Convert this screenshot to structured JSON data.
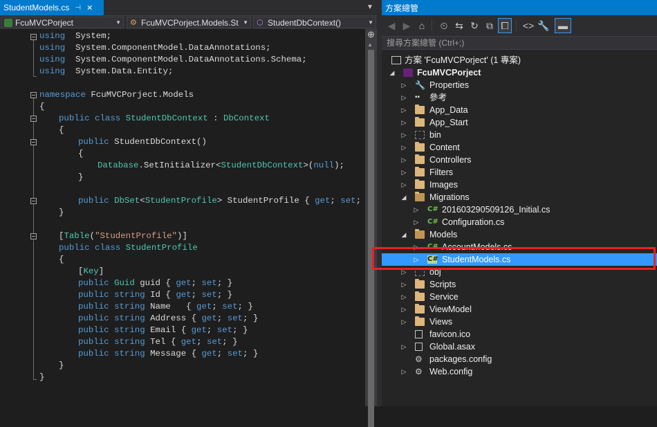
{
  "colors": {
    "accent": "#007acc",
    "keyword": "#569cd6",
    "type": "#4ec9b0",
    "string": "#d69d85",
    "selection": "#3399ff",
    "highlight_box": "#e8202a"
  },
  "editor": {
    "tab": {
      "label": "StudentModels.cs",
      "pin_icon": "pin-icon",
      "close_icon": "close-icon"
    },
    "nav": {
      "project": "FcuMVCPorject",
      "class": "FcuMVCPorject.Models.St",
      "member": "StudentDbContext()"
    },
    "lines": [
      [
        "using ",
        " System;"
      ],
      [
        "using ",
        " System.ComponentModel.DataAnnotations;"
      ],
      [
        "using ",
        " System.ComponentModel.DataAnnotations.Schema;"
      ],
      [
        "using ",
        " System.Data.Entity;"
      ],
      [
        "namespace ",
        "FcuMVCPorject.Models"
      ],
      [
        "{"
      ],
      [
        "public class ",
        "StudentDbContext",
        " : ",
        "DbContext"
      ],
      [
        "{"
      ],
      [
        "public ",
        "StudentDbContext",
        "()"
      ],
      [
        "{"
      ],
      [
        "Database",
        ".SetInitializer<",
        "StudentDbContext",
        ">(",
        "null",
        ");"
      ],
      [
        "}"
      ],
      [
        "public ",
        "DbSet",
        "<",
        "StudentProfile",
        "> StudentProfile { ",
        "get",
        "; ",
        "set",
        "; }"
      ],
      [
        "}"
      ],
      [
        "[",
        "Table",
        "(",
        "\"StudentProfile\"",
        ")]"
      ],
      [
        "public class ",
        "StudentProfile"
      ],
      [
        "{"
      ],
      [
        "[",
        "Key",
        "]"
      ],
      [
        "public ",
        "Guid",
        " guid { ",
        "get",
        "; ",
        "set",
        "; }"
      ],
      [
        "public ",
        "string",
        " Id { ",
        "get",
        "; ",
        "set",
        "; }"
      ],
      [
        "public ",
        "string",
        " Name   { ",
        "get",
        "; ",
        "set",
        "; }"
      ],
      [
        "public ",
        "string",
        " Address { ",
        "get",
        "; ",
        "set",
        "; }"
      ],
      [
        "public ",
        "string",
        " Email { ",
        "get",
        "; ",
        "set",
        "; }"
      ],
      [
        "public ",
        "string",
        " Tel { ",
        "get",
        "; ",
        "set",
        "; }"
      ],
      [
        "public ",
        "string",
        " Message { ",
        "get",
        "; ",
        "set",
        "; }"
      ],
      [
        "}"
      ],
      [
        "}"
      ]
    ]
  },
  "solution_explorer": {
    "title": "方案總管",
    "search_placeholder": "搜尋方案總管 (Ctrl+;)",
    "toolbar_icons": [
      "back-icon",
      "forward-icon",
      "home-icon",
      "history-icon",
      "sync-icon",
      "refresh-icon",
      "collapse-all-icon",
      "show-all-files-icon",
      "view-code-icon",
      "properties-icon",
      "preview-icon"
    ],
    "solution_label": "方案 'FcuMVCPorject' (1 專案)",
    "project_label": "FcuMVCPorject",
    "items": [
      {
        "label": "Properties",
        "icon": "wrench-icon"
      },
      {
        "label": "參考",
        "icon": "references-icon"
      },
      {
        "label": "App_Data",
        "icon": "folder-icon"
      },
      {
        "label": "App_Start",
        "icon": "folder-icon"
      },
      {
        "label": "bin",
        "icon": "hidden-folder-icon"
      },
      {
        "label": "Content",
        "icon": "folder-icon"
      },
      {
        "label": "Controllers",
        "icon": "folder-icon"
      },
      {
        "label": "Filters",
        "icon": "folder-icon"
      },
      {
        "label": "Images",
        "icon": "folder-icon"
      },
      {
        "label": "Migrations",
        "icon": "folder-open-icon"
      },
      {
        "label": "201603290509126_Initial.cs",
        "icon": "csharp-file-icon"
      },
      {
        "label": "Configuration.cs",
        "icon": "csharp-file-icon"
      },
      {
        "label": "Models",
        "icon": "folder-open-icon"
      },
      {
        "label": "AccountModels.cs",
        "icon": "csharp-file-icon"
      },
      {
        "label": "StudentModels.cs",
        "icon": "csharp-file-icon"
      },
      {
        "label": "obj",
        "icon": "hidden-folder-icon"
      },
      {
        "label": "Scripts",
        "icon": "folder-icon"
      },
      {
        "label": "Service",
        "icon": "folder-icon"
      },
      {
        "label": "ViewModel",
        "icon": "folder-icon"
      },
      {
        "label": "Views",
        "icon": "folder-icon"
      },
      {
        "label": "favicon.ico",
        "icon": "file-icon"
      },
      {
        "label": "Global.asax",
        "icon": "file-icon"
      },
      {
        "label": "packages.config",
        "icon": "config-file-icon"
      },
      {
        "label": "Web.config",
        "icon": "config-file-icon"
      }
    ],
    "selected_item": "StudentModels.cs"
  }
}
